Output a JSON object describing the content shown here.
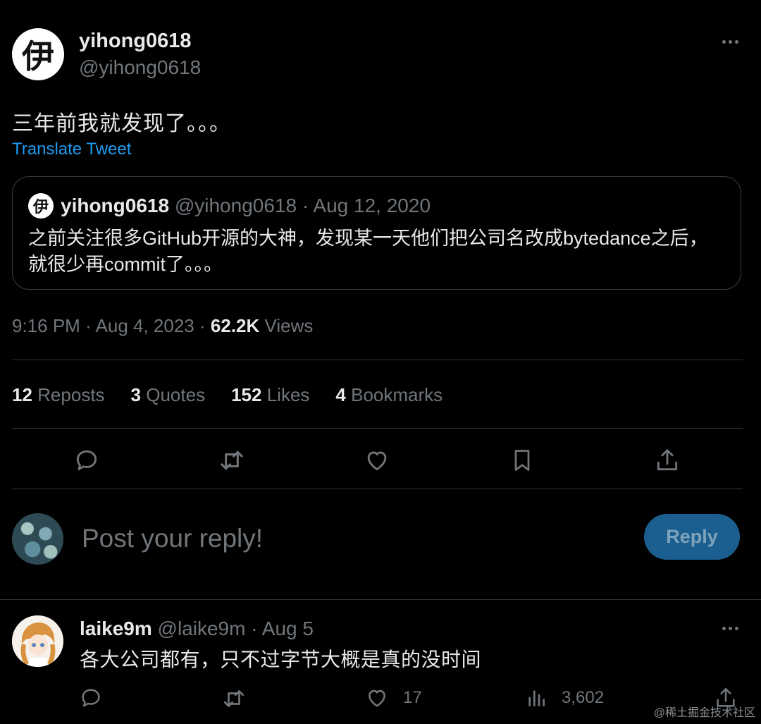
{
  "tweet": {
    "author": {
      "avatar_glyph": "伊",
      "name": "yihong0618",
      "handle": "@yihong0618"
    },
    "text": "三年前我就发现了。。。",
    "translate_label": "Translate Tweet",
    "quote": {
      "avatar_glyph": "伊",
      "name": "yihong0618",
      "handle": "@yihong0618",
      "separator": "·",
      "date": "Aug 12, 2020",
      "text": "之前关注很多GitHub开源的大神，发现某一天他们把公司名改成bytedance之后，就很少再commit了。。。"
    },
    "meta": {
      "time": "9:16 PM",
      "sep1": "·",
      "date": "Aug 4, 2023",
      "sep2": "·",
      "views_count": "62.2K",
      "views_label": "Views"
    },
    "stats": [
      {
        "count": "12",
        "label": "Reposts"
      },
      {
        "count": "3",
        "label": "Quotes"
      },
      {
        "count": "152",
        "label": "Likes"
      },
      {
        "count": "4",
        "label": "Bookmarks"
      }
    ],
    "actions": [
      "reply-icon",
      "repost-icon",
      "like-icon",
      "bookmark-icon",
      "share-icon"
    ]
  },
  "composer": {
    "placeholder": "Post your reply!",
    "button_label": "Reply"
  },
  "comment": {
    "name": "laike9m",
    "handle": "@laike9m",
    "separator": "·",
    "date": "Aug 5",
    "text": "各大公司都有，只不过字节大概是真的没时间",
    "likes": "17",
    "views": "3,602"
  },
  "watermark": "@稀土掘金技术社区",
  "colors": {
    "background": "#000000",
    "text": "#e7e9ea",
    "muted": "#71767b",
    "link": "#1d9bf0",
    "reply_button": "#1a5f8f"
  }
}
